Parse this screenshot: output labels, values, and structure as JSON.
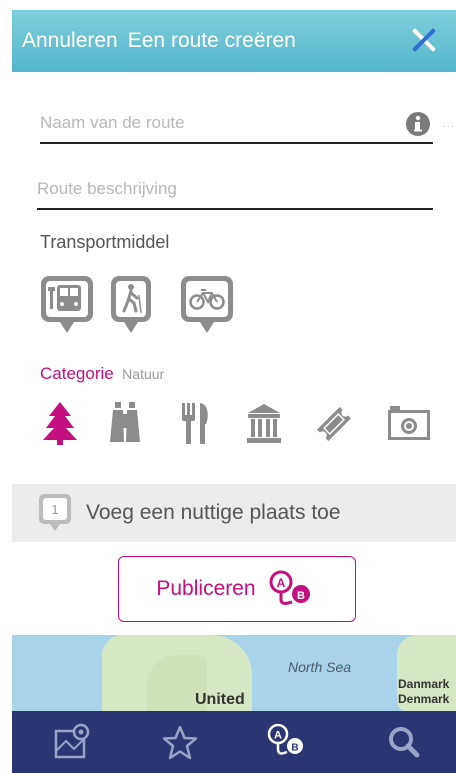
{
  "header": {
    "cancel_label": "Annuleren",
    "title": "Een route creëren",
    "close_icon": "close-x-icon"
  },
  "form": {
    "route_name": {
      "placeholder": "Naam van de route",
      "value": ""
    },
    "route_description": {
      "placeholder": "Route beschrijving",
      "value": ""
    },
    "info_dots": "..."
  },
  "transport": {
    "label": "Transportmiddel",
    "options": [
      {
        "name": "bus",
        "icon": "bus-icon"
      },
      {
        "name": "walk",
        "icon": "hiker-icon"
      },
      {
        "name": "bike",
        "icon": "bicycle-icon"
      }
    ]
  },
  "category": {
    "label": "Categorie",
    "selected": "Natuur",
    "icons": [
      "tree-icon",
      "binoculars-icon",
      "fork-knife-icon",
      "museum-icon",
      "ticket-icon",
      "camera-icon"
    ]
  },
  "poi": {
    "badge": "1",
    "label": "Voeg een nuttige plaats toe"
  },
  "publish": {
    "label": "Publiceren",
    "icon": "route-a-b-icon"
  },
  "map": {
    "sea_label": "North Sea",
    "land_label": "United",
    "country1": "Danmark",
    "country2": "Denmark"
  },
  "tabbar": {
    "items": [
      "map-pin-icon",
      "star-icon",
      "route-a-b-icon",
      "search-icon"
    ]
  },
  "colors": {
    "header": "#55b6cb",
    "accent": "#c40f7f",
    "tabbar": "#2b3573",
    "icon_gray": "#8c8c8c"
  }
}
